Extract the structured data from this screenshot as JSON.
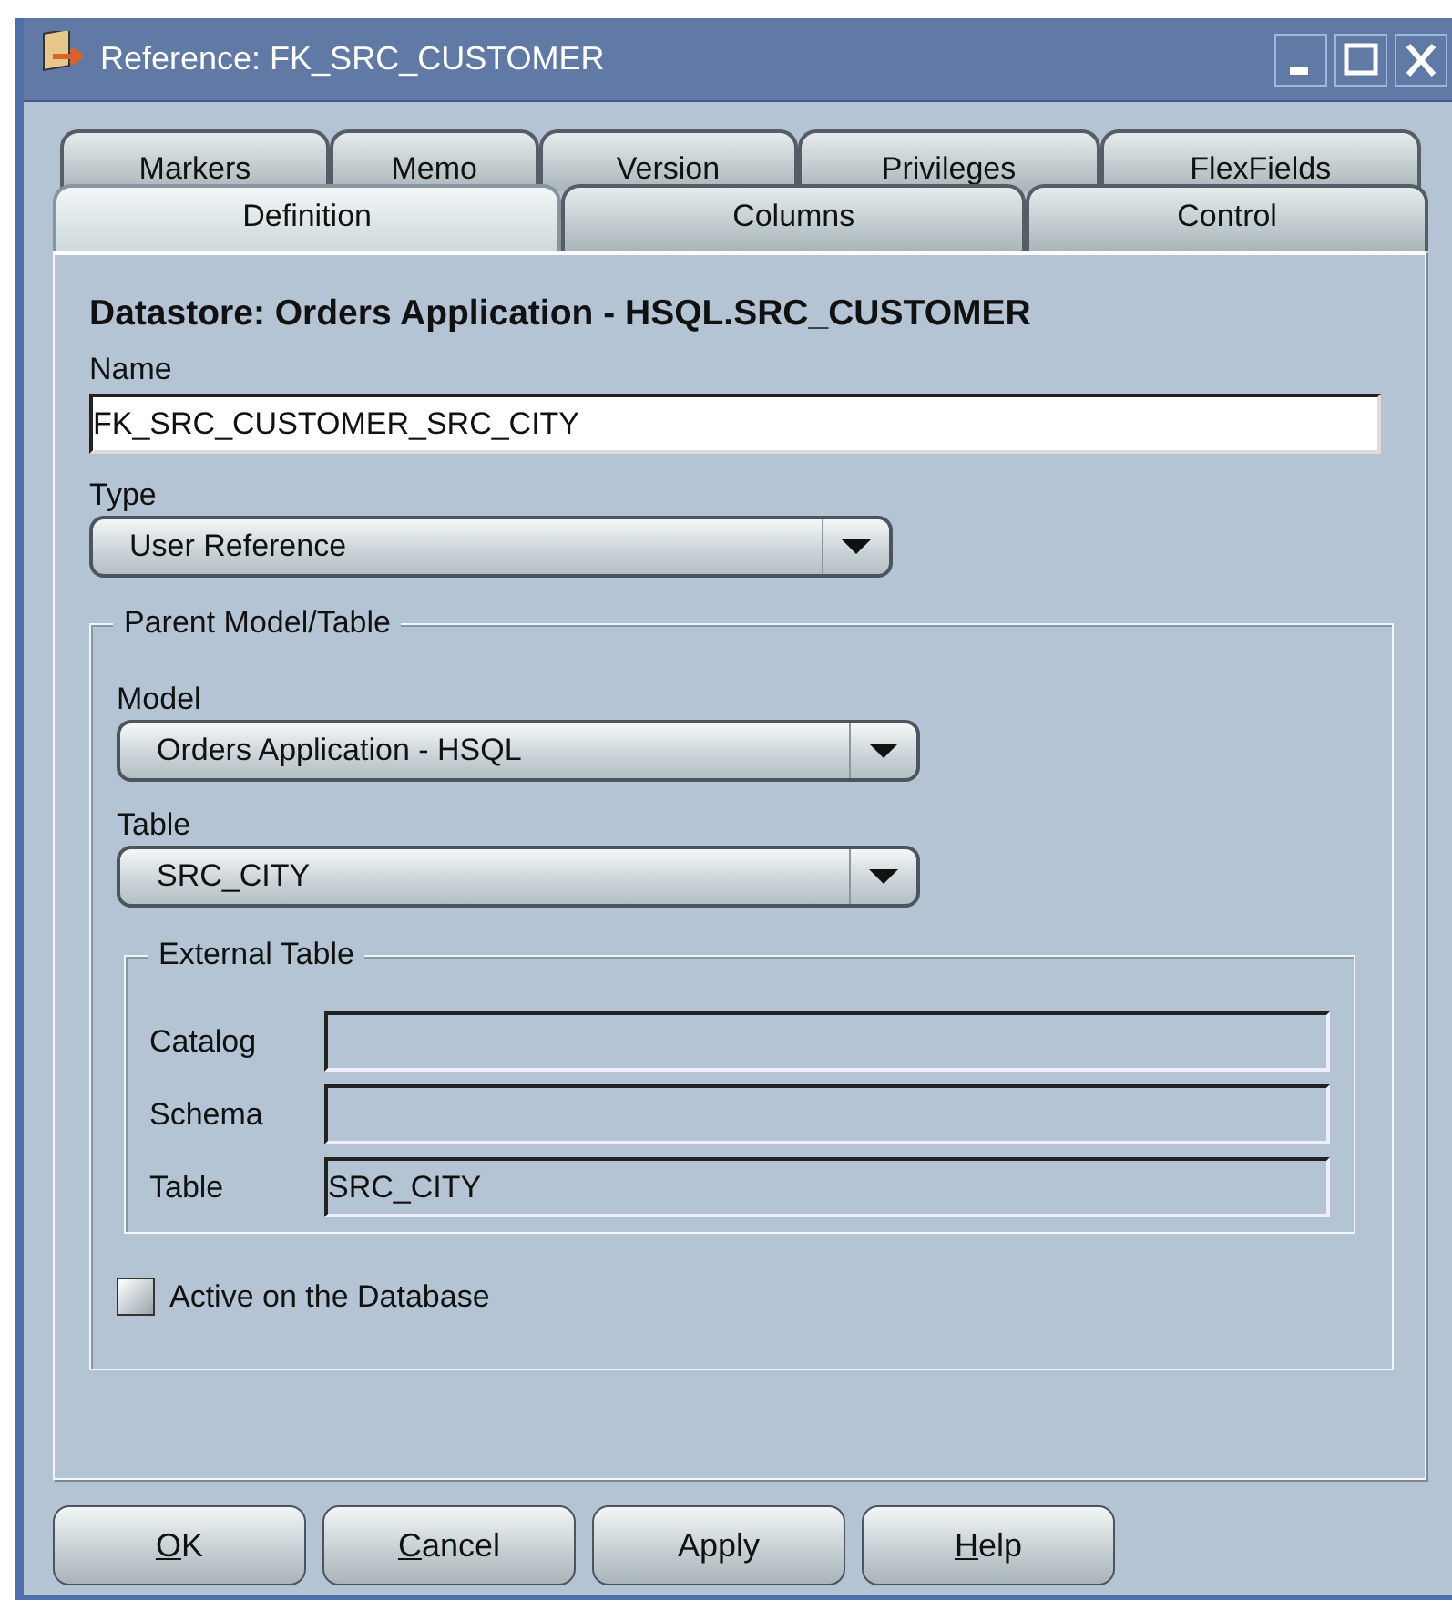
{
  "window": {
    "title": "Reference: FK_SRC_CUSTOMER"
  },
  "tabs": {
    "back_row": [
      {
        "label": "Markers",
        "selected": false
      },
      {
        "label": "Memo",
        "selected": false
      },
      {
        "label": "Version",
        "selected": false
      },
      {
        "label": "Privileges",
        "selected": false
      },
      {
        "label": "FlexFields",
        "selected": false
      }
    ],
    "front_row": [
      {
        "label": "Definition",
        "selected": true
      },
      {
        "label": "Columns",
        "selected": false
      },
      {
        "label": "Control",
        "selected": false
      }
    ]
  },
  "heading": "Datastore: Orders Application - HSQL.SRC_CUSTOMER",
  "name": {
    "label": "Name",
    "value": "FK_SRC_CUSTOMER_SRC_CITY",
    "disabled": false
  },
  "type": {
    "label": "Type",
    "value": "User Reference"
  },
  "parent_group": {
    "title": "Parent Model/Table",
    "model": {
      "label": "Model",
      "value": "Orders Application - HSQL"
    },
    "table": {
      "label": "Table",
      "value": "SRC_CITY"
    },
    "external_group": {
      "title": "External Table",
      "fields": [
        {
          "label": "Catalog",
          "disabled": true
        },
        {
          "label": "Schema",
          "disabled": true
        },
        {
          "label": "Table",
          "value": "SRC_CITY",
          "disabled": true
        }
      ]
    },
    "active_checkbox": {
      "label": "Active on the Database",
      "checked": false
    }
  },
  "buttons": [
    {
      "label": "OK",
      "underline_first": true
    },
    {
      "label": "Cancel",
      "underline_first": true
    },
    {
      "label": "Apply",
      "underline_first": false
    },
    {
      "label": "Help",
      "underline_first": true
    }
  ]
}
